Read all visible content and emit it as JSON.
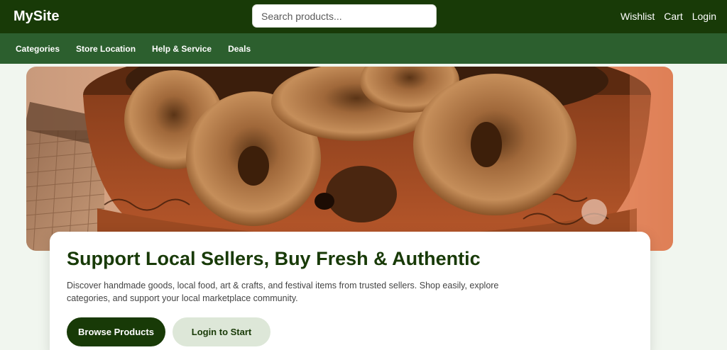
{
  "header": {
    "logo": "MySite",
    "search_placeholder": "Search products...",
    "links": [
      "Wishlist",
      "Cart",
      "Login"
    ]
  },
  "nav": {
    "items": [
      "Categories",
      "Store Location",
      "Help & Service",
      "Deals"
    ]
  },
  "hero": {
    "image_description": "dried-figs-in-bowl"
  },
  "intro": {
    "title": "Support Local Sellers, Buy Fresh & Authentic",
    "description": "Discover handmade goods, local food, art & crafts, and festival items from trusted sellers. Shop easily, explore categories, and support your local marketplace community.",
    "primary_button": "Browse Products",
    "secondary_button": "Login to Start"
  },
  "colors": {
    "header_bg": "#183a07",
    "nav_bg": "#2c5f2e",
    "page_bg": "#f1f6ef",
    "accent": "#183a07",
    "secondary_btn_bg": "#dde7d8"
  }
}
